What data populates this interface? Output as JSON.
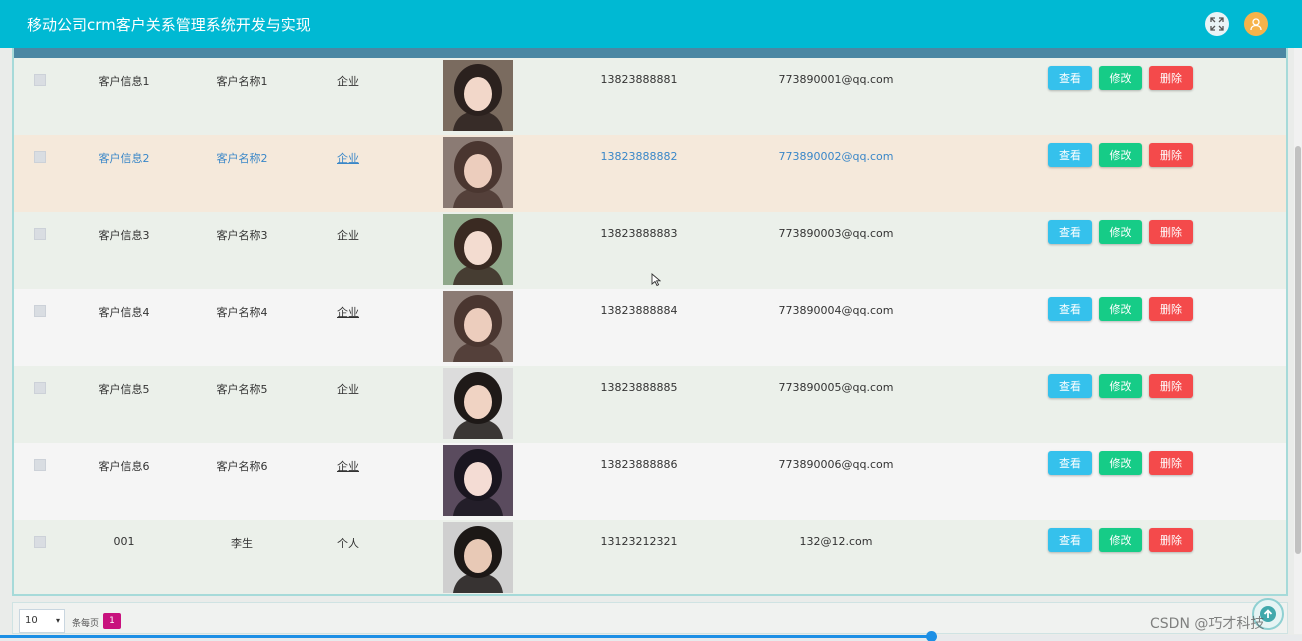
{
  "app": {
    "title": "移动公司crm客户关系管理系统开发与实现",
    "accent_color": "#00b9d3",
    "icons": [
      "fullscreen-icon",
      "user-avatar-icon"
    ]
  },
  "table": {
    "rows": [
      {
        "info": "客户信息1",
        "name": "客户名称1",
        "type": "企业",
        "phone": "13823888881",
        "email": "773890001@qq.com",
        "bg": "#ebf0ea",
        "avatar_bg": "#7a6b5f",
        "avatar_face": "#f2d7c9",
        "avatar_hair": "#2b211e"
      },
      {
        "info": "客户信息2",
        "name": "客户名称2",
        "type": "企业",
        "phone": "13823888882",
        "email": "773890002@qq.com",
        "bg": "#f5e9db",
        "avatar_bg": "#8b7b74",
        "avatar_face": "#eccdbd",
        "avatar_hair": "#4a3630"
      },
      {
        "info": "客户信息3",
        "name": "客户名称3",
        "type": "企业",
        "phone": "13823888883",
        "email": "773890003@qq.com",
        "bg": "#ebf0ea",
        "avatar_bg": "#8fa88a",
        "avatar_face": "#f3dcd0",
        "avatar_hair": "#3a2a22"
      },
      {
        "info": "客户信息4",
        "name": "客户名称4",
        "type": "企业",
        "phone": "13823888884",
        "email": "773890004@qq.com",
        "bg": "#f5f5f5",
        "avatar_bg": "#8b7b74",
        "avatar_face": "#eccdbd",
        "avatar_hair": "#4a3630"
      },
      {
        "info": "客户信息5",
        "name": "客户名称5",
        "type": "企业",
        "phone": "13823888885",
        "email": "773890005@qq.com",
        "bg": "#ebf0ea",
        "avatar_bg": "#dcdcdc",
        "avatar_face": "#f0d3c3",
        "avatar_hair": "#1f1a18"
      },
      {
        "info": "客户信息6",
        "name": "客户名称6",
        "type": "企业",
        "phone": "13823888886",
        "email": "773890006@qq.com",
        "bg": "#f5f5f5",
        "avatar_bg": "#5a4b5e",
        "avatar_face": "#f4dcd4",
        "avatar_hair": "#1a1620"
      },
      {
        "info": "001",
        "name": "李生",
        "type": "个人",
        "phone": "13123212321",
        "email": "132@12.com",
        "bg": "#ebf0ea",
        "avatar_bg": "#cfcfcf",
        "avatar_face": "#e8c9b6",
        "avatar_hair": "#1c1816"
      }
    ],
    "actions": {
      "view": "查看",
      "edit": "修改",
      "delete": "删除"
    }
  },
  "pagination": {
    "page_size": "10",
    "per_page_label": "条每页",
    "current_page": "1"
  },
  "watermark": "CSDN @巧才科技",
  "video_progress_fraction": 0.715
}
